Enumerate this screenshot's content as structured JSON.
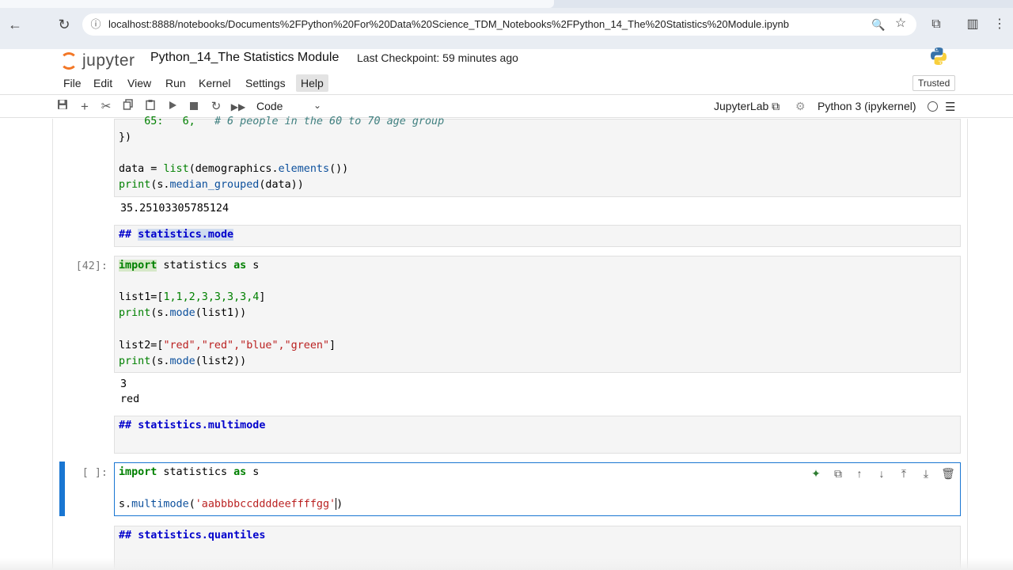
{
  "browser": {
    "url": "localhost:8888/notebooks/Documents%2FPython%20For%20Data%20Science_TDM_Notebooks%2FPython_14_The%20Statistics%20Module.ipynb",
    "back_icon": "←",
    "reload_icon": "↻",
    "info_icon": "ⓘ",
    "zoom_icon": "🔍",
    "star_icon": "☆",
    "extensions_icon": "⧉",
    "profile_icon": "▥",
    "menu_icon": "⋮"
  },
  "jupyter": {
    "logo_text": "jupyter",
    "notebook_title": "Python_14_The Statistics Module",
    "checkpoint": "Last Checkpoint: 59 minutes ago",
    "trusted": "Trusted"
  },
  "menu": {
    "items": [
      "File",
      "Edit",
      "View",
      "Run",
      "Kernel",
      "Settings",
      "Help"
    ]
  },
  "toolbar": {
    "cell_type": "Code",
    "jupyterlab_link": "JupyterLab ⧉",
    "kernel_name": "Python 3 (ipykernel)"
  },
  "cells": {
    "c1": {
      "line1_num": "65:",
      "line1_val": "6,",
      "line1_comment": "# 6 people in the 60 to 70 age group",
      "line2": "})",
      "line3_a": "data = ",
      "line3_b": "list",
      "line3_c": "(demographics.",
      "line3_d": "elements",
      "line3_e": "())",
      "line4_a": "print",
      "line4_b": "(s.",
      "line4_c": "median_grouped",
      "line4_d": "(data))",
      "output": "35.25103305785124"
    },
    "md_mode": {
      "hash": "##",
      "title": "statistics.mode"
    },
    "c2": {
      "prompt": "[42]:",
      "line1_k1": "import",
      "line1_m": " statistics ",
      "line1_k2": "as",
      "line1_s": " s",
      "line2_a": "list1=[",
      "line2_nums": "1,1,2,3,3,3,3,4",
      "line2_b": "]",
      "line3_a": "print",
      "line3_b": "(s.",
      "line3_c": "mode",
      "line3_d": "(list1))",
      "line4_a": "list2=[",
      "line4_strs": "\"red\",\"red\",\"blue\",\"green\"",
      "line4_b": "]",
      "line5_a": "print",
      "line5_b": "(s.",
      "line5_c": "mode",
      "line5_d": "(list2))",
      "output1": "3",
      "output2": "red"
    },
    "md_multimode": {
      "hash": "##",
      "title": "statistics.multimode"
    },
    "c3": {
      "prompt": "[ ]:",
      "line1_k1": "import",
      "line1_m": " statistics ",
      "line1_k2": "as",
      "line1_s": " s",
      "line2_a": "s.",
      "line2_fn": "multimode",
      "line2_b": "(",
      "line2_str": "'aabbbbccddddeeffffgg'",
      "line2_c": ")"
    },
    "md_quantiles": {
      "hash": "##",
      "title": "statistics.quantiles"
    }
  }
}
